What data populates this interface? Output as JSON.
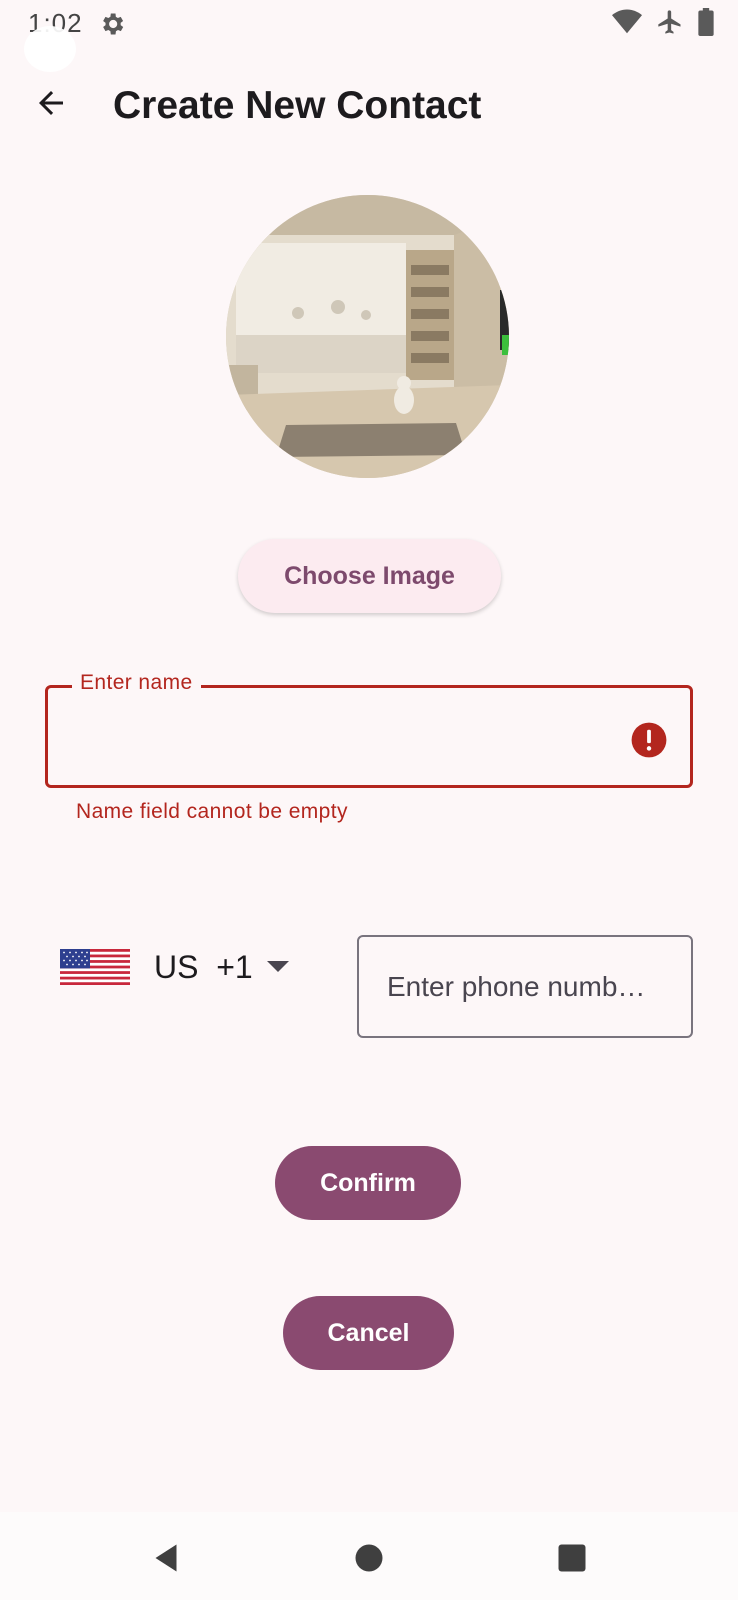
{
  "status_bar": {
    "time": "1:02",
    "icons": [
      "settings-gear-icon",
      "wifi-icon",
      "airplane-mode-icon",
      "battery-icon"
    ]
  },
  "app_bar": {
    "back_icon": "arrow-back-icon",
    "title": "Create New Contact"
  },
  "avatar": {
    "icon": "contact-photo"
  },
  "choose_image_label": "Choose Image",
  "name_field": {
    "label": "Enter name",
    "value": "",
    "error_icon": "error-alert-icon",
    "error_text": "Name field cannot be empty"
  },
  "phone": {
    "country_flag": "us-flag-icon",
    "country_code": "US  +1",
    "placeholder": "Enter phone numb…"
  },
  "confirm_label": "Confirm",
  "cancel_label": "Cancel",
  "nav_bar": {
    "icons": [
      "nav-back-icon",
      "nav-home-icon",
      "nav-recents-icon"
    ]
  },
  "colors": {
    "background": "#fdf7f8",
    "primary": "#8a4a70",
    "tonal_button": "#fcebf0",
    "tonal_text": "#7d4a6d",
    "error": "#b3261e",
    "outline": "#79747e"
  }
}
